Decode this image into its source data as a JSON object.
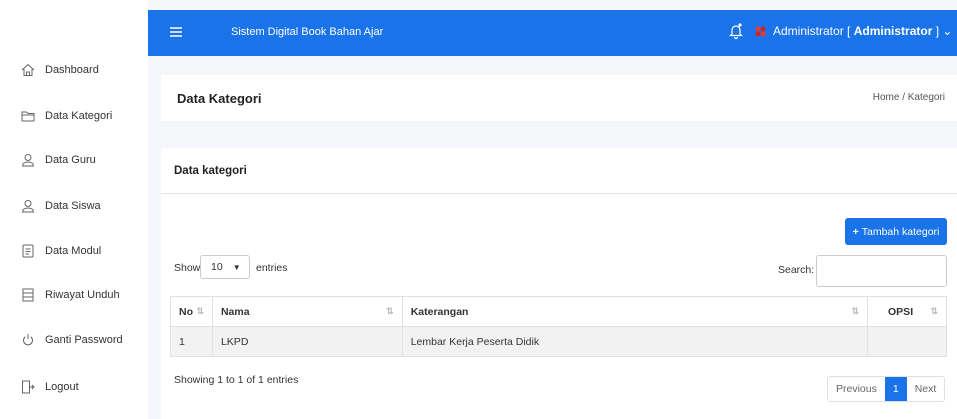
{
  "sidebar": {
    "items": [
      {
        "label": "Dashboard",
        "icon": "home-icon"
      },
      {
        "label": "Data Kategori",
        "icon": "folder-icon"
      },
      {
        "label": "Data Guru",
        "icon": "user-icon"
      },
      {
        "label": "Data Siswa",
        "icon": "user-icon"
      },
      {
        "label": "Data Modul",
        "icon": "file-icon"
      },
      {
        "label": "Riwayat Unduh",
        "icon": "archive-icon"
      },
      {
        "label": "Ganti Password",
        "icon": "power-icon"
      },
      {
        "label": "Logout",
        "icon": "logout-icon"
      }
    ]
  },
  "topbar": {
    "title": "Sistem Digital Book Bahan Ajar",
    "user_name": "Administrator",
    "user_role": "Administrator",
    "accent": "#1a73e8"
  },
  "header": {
    "title": "Data Kategori",
    "breadcrumb": "Home / Kategori"
  },
  "card": {
    "title": "Data kategori",
    "add_button": "Tambah kategori",
    "show_label": "Show",
    "entries_value": "10",
    "entries_label": "entries",
    "search_label": "Search:",
    "search_value": ""
  },
  "table": {
    "columns": [
      "No",
      "Nama",
      "Katerangan",
      "OPSI"
    ],
    "rows": [
      {
        "no": "1",
        "nama": "LKPD",
        "keterangan": "Lembar Kerja Peserta Didik",
        "opsi": ""
      }
    ]
  },
  "footer": {
    "info": "Showing 1 to 1 of 1 entries",
    "prev": "Previous",
    "page": "1",
    "next": "Next"
  }
}
